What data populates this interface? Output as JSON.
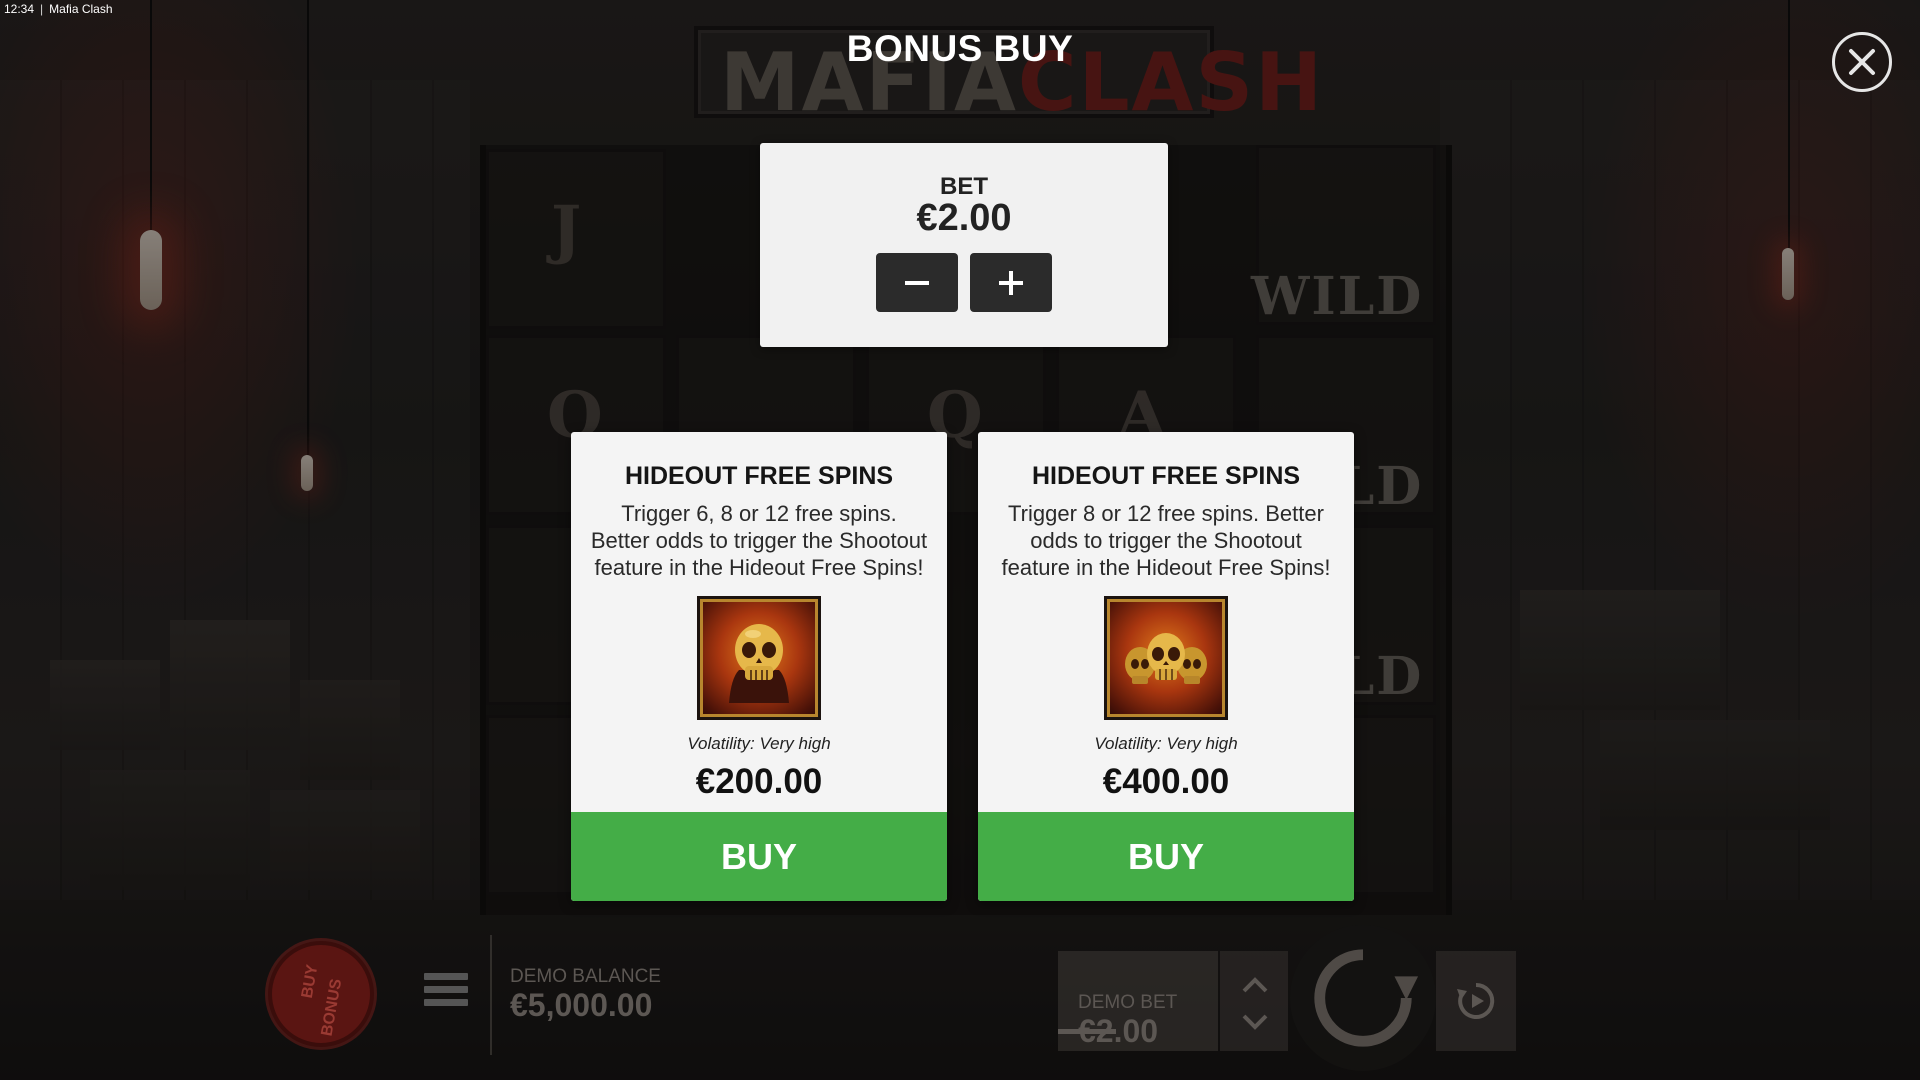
{
  "status_bar": {
    "time": "12:34",
    "separator": "|",
    "app_title": "Mafia Clash"
  },
  "background": {
    "logo_word_1": "MAFIA",
    "logo_word_2": "CLASH",
    "reel_symbols": [
      "J",
      "Q",
      "Q",
      "A"
    ],
    "wild_label": "WILD"
  },
  "modal": {
    "title": "BONUS BUY",
    "close_icon": "close-icon",
    "bet": {
      "label": "BET",
      "value": "€2.00",
      "decrease_icon": "minus-icon",
      "increase_icon": "plus-icon"
    },
    "cards": [
      {
        "title": "HIDEOUT FREE SPINS",
        "description": "Trigger 6, 8 or 12 free spins. Better odds to trigger the Shootout feature in the Hideout Free Spins!",
        "image_icon": "golden-skull-icon",
        "volatility": "Volatility: Very high",
        "price": "€200.00",
        "buy_label": "BUY"
      },
      {
        "title": "HIDEOUT FREE SPINS",
        "description": "Trigger 8 or 12 free spins. Better odds to trigger the Shootout feature in the Hideout Free Spins!",
        "image_icon": "triple-golden-skull-icon",
        "volatility": "Volatility: Very high",
        "price": "€400.00",
        "buy_label": "BUY"
      }
    ]
  },
  "bottom_bar": {
    "buy_bonus_label_1": "BUY",
    "buy_bonus_label_2": "BONUS",
    "menu_icon": "menu-icon",
    "balance_label": "DEMO BALANCE",
    "balance_value": "€5,000.00",
    "bet_label": "DEMO BET",
    "bet_value": "€2.00",
    "bet_up_icon": "chevron-up-icon",
    "bet_down_icon": "chevron-down-icon",
    "spin_icon": "spin-icon",
    "autoplay_icon": "autoplay-icon"
  },
  "colors": {
    "buy_green": "#44ad47",
    "panel_bg": "#f4f4f4",
    "stepper_dark": "#2b2b2b",
    "bonus_red": "#5a1512"
  }
}
